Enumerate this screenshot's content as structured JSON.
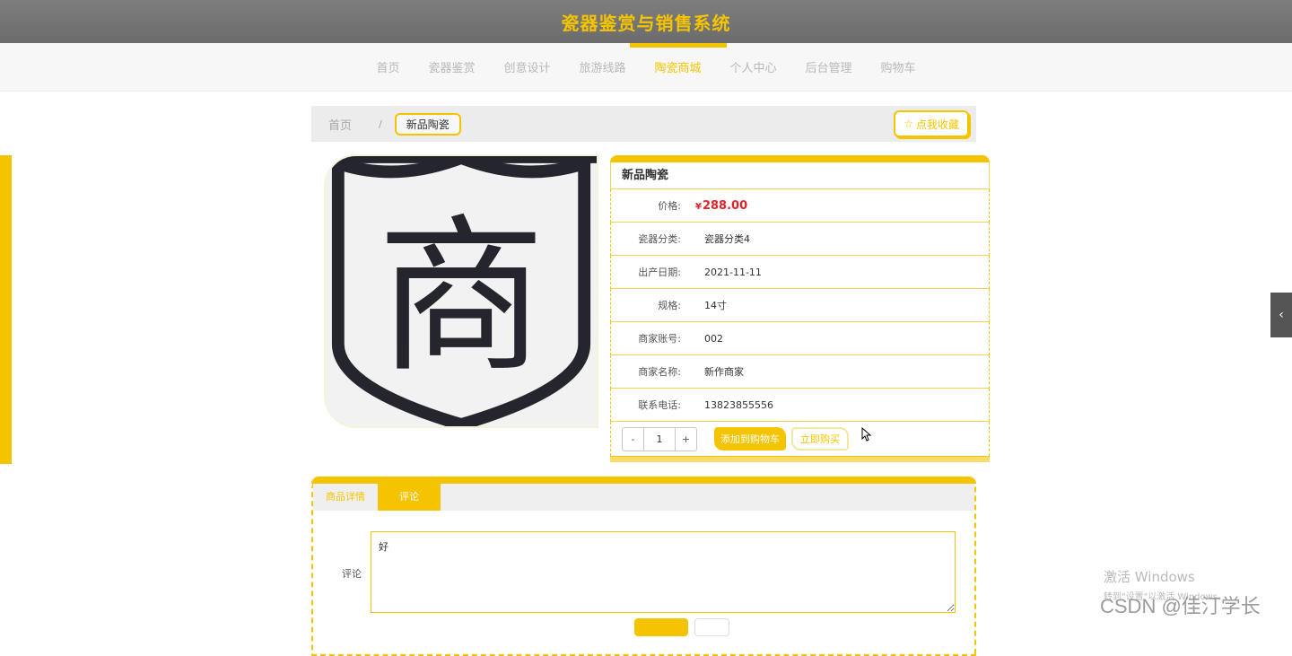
{
  "header": {
    "title": "瓷器鉴赏与销售系统"
  },
  "nav": {
    "items": [
      {
        "label": "首页"
      },
      {
        "label": "瓷器鉴赏"
      },
      {
        "label": "创意设计"
      },
      {
        "label": "旅游线路"
      },
      {
        "label": "陶瓷商城"
      },
      {
        "label": "个人中心"
      },
      {
        "label": "后台管理"
      },
      {
        "label": "购物车"
      }
    ],
    "active_index": 4
  },
  "breadcrumb": {
    "home": "首页",
    "separator": "/",
    "current": "新品陶瓷"
  },
  "favorite_button": {
    "icon": "star-icon",
    "label": "点我收藏"
  },
  "product": {
    "image_glyph": "商",
    "name": "新品陶瓷",
    "price_currency": "¥",
    "price": "288.00",
    "fields": [
      {
        "label": "瓷器分类:",
        "value": "瓷器分类4"
      },
      {
        "label": "出产日期:",
        "value": "2021-11-11"
      },
      {
        "label": "规格:",
        "value": "14寸"
      },
      {
        "label": "商家账号:",
        "value": "002"
      },
      {
        "label": "商家名称:",
        "value": "新作商家"
      },
      {
        "label": "联系电话:",
        "value": "13823855556"
      }
    ],
    "price_label": "价格:"
  },
  "purchase": {
    "minus": "-",
    "quantity": "1",
    "plus": "+",
    "add_to_cart": "添加到购物车",
    "buy_now": "立即购买"
  },
  "tabs": {
    "items": [
      {
        "label": "商品详情"
      },
      {
        "label": "评论"
      }
    ],
    "active_index": 1
  },
  "comment": {
    "label": "评论",
    "value": "好"
  },
  "side_toggle": {
    "icon": "chevron-left-icon"
  },
  "watermark": {
    "title": "激活 Windows",
    "subtitle": "转到\"设置\"以激活 Windows。",
    "csdn": "CSDN @佳汀学长"
  },
  "colors": {
    "accent": "#f5c400",
    "price": "#e0242b",
    "header_bg": "#757575"
  }
}
